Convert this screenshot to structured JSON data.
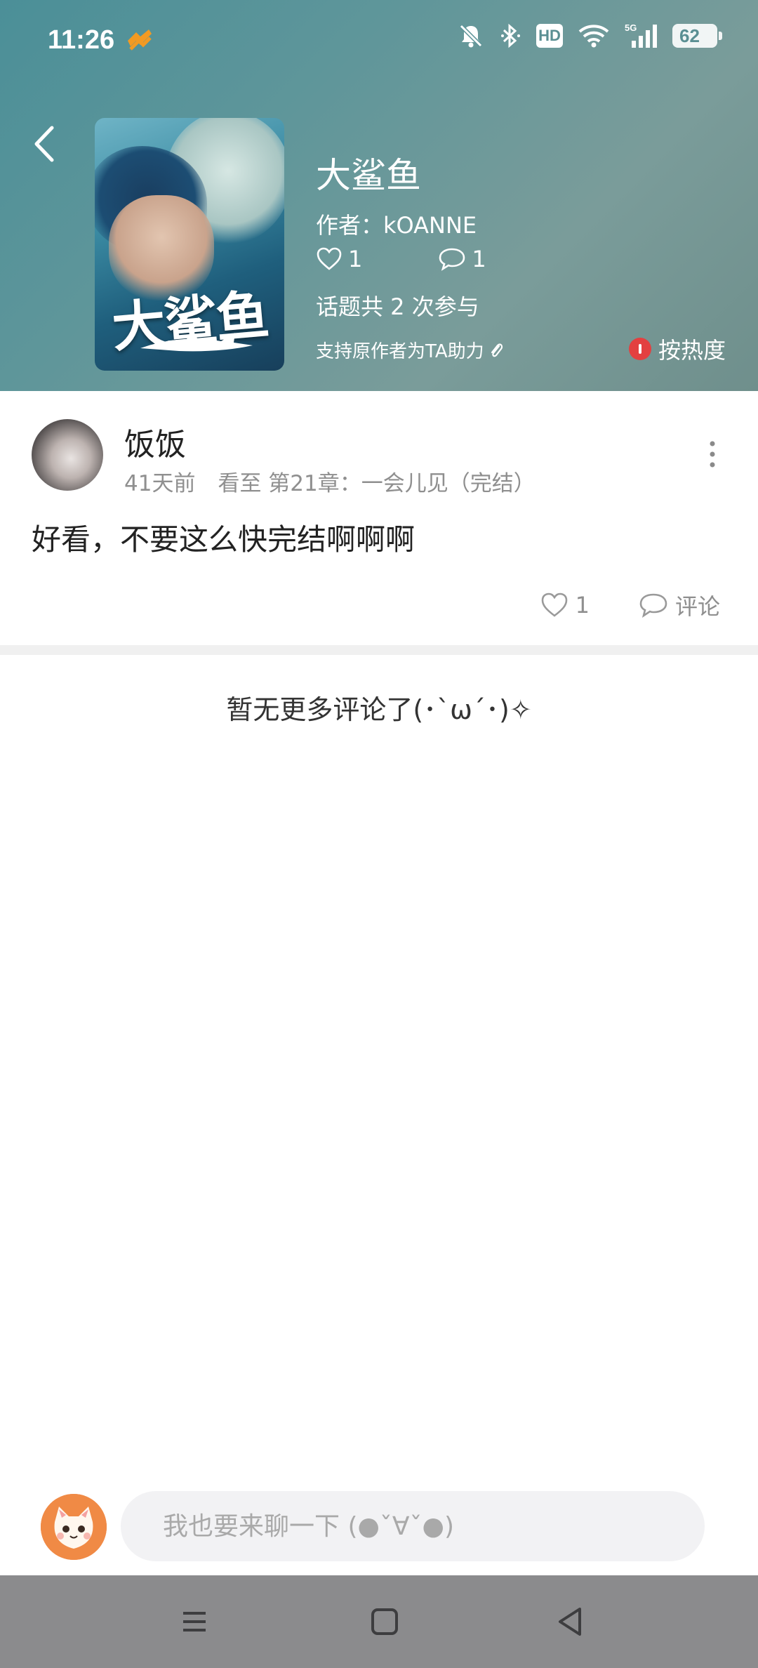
{
  "status_bar": {
    "time": "11:26",
    "battery": "62",
    "network": "5G",
    "hd": "HD"
  },
  "book": {
    "title": "大鲨鱼",
    "cover_title": "大鲨鱼",
    "author_label": "作者：kOANNE",
    "likes": "1",
    "comments": "1",
    "topic_text": "话题共 2 次参与",
    "support_text": "支持原作者为TA助力",
    "sort_label": "按热度"
  },
  "comment": {
    "username": "饭饭",
    "time_ago": "41天前",
    "progress": "看至 第21章：一会儿见（完结）",
    "text": "好看，不要这么快完结啊啊啊",
    "likes": "1",
    "reply_label": "评论"
  },
  "footer": {
    "no_more": "暂无更多评论了(･`ω´･)✧"
  },
  "reply_box": {
    "placeholder": "我也要来聊一下 (●ˇ∀ˇ●)"
  },
  "colors": {
    "header_bg": "#5f969a",
    "accent_red": "#e34040",
    "nav_bg": "#8b8b8d"
  }
}
